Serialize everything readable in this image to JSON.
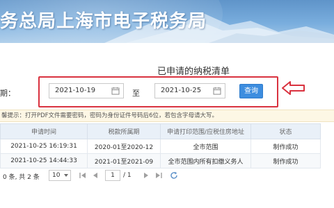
{
  "banner": {
    "title": "务总局上海市电子税务局"
  },
  "page": {
    "title": "已申请的纳税清单"
  },
  "filter": {
    "date_label": "期：",
    "date_from": "2021-10-19",
    "separator": "至",
    "date_to": "2021-10-25",
    "query_label": "查询"
  },
  "hint": {
    "text": "馨提示：打开PDF文件需要密码，密码为身份证件号码后6位，若包含字母请大写。"
  },
  "table": {
    "headers": [
      "申请时间",
      "税款所属期",
      "申请打印范围/应税住房地址",
      "状态"
    ],
    "rows": [
      [
        "2021-10-25 16:19:31",
        "2020-01至2020-12",
        "全市范围",
        "制作成功"
      ],
      [
        "2021-10-25 14:44:33",
        "2021-01至2021-09",
        "全市范围内所有扣缴义务人",
        "制作成功"
      ]
    ]
  },
  "pager": {
    "count_text": "0 条, 共 2 条",
    "page_size": "10",
    "current_page": "1",
    "total_text": "/ 1"
  },
  "colors": {
    "accent": "#3d8ddf",
    "highlight": "#d9323f",
    "hint_bg": "#fdf7e5",
    "header_bg": "#e9f0f8"
  },
  "icons": [
    "calendar-icon",
    "arrow-left-icon",
    "first-page-icon",
    "prev-page-icon",
    "next-page-icon",
    "last-page-icon",
    "refresh-icon",
    "chevron-down-icon"
  ]
}
